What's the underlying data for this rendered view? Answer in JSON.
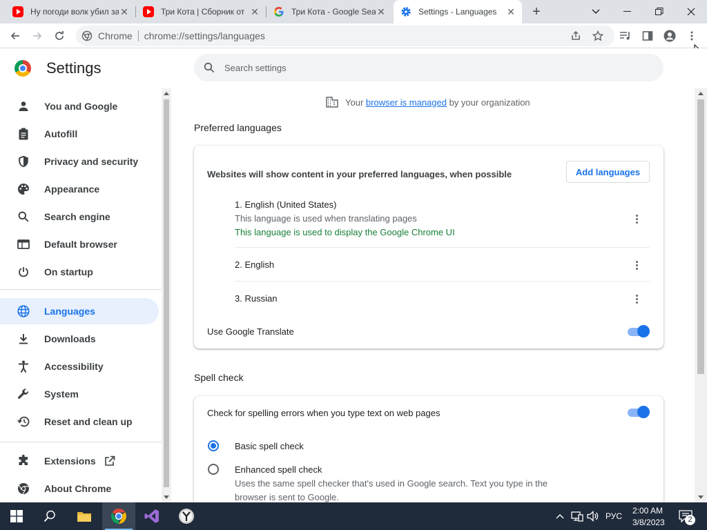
{
  "tabs": [
    {
      "title": "Ну погоди волк убил зайца",
      "icon": "youtube-icon"
    },
    {
      "title": "Три Кота | Сборник от",
      "icon": "youtube-icon"
    },
    {
      "title": "Три Кота - Google Search",
      "icon": "google-icon"
    },
    {
      "title": "Settings - Languages",
      "icon": "settings-gear-icon",
      "active": true
    }
  ],
  "toolbar": {
    "site_label": "Chrome",
    "url": "chrome://settings/languages"
  },
  "settings": {
    "title": "Settings",
    "search_placeholder": "Search settings"
  },
  "sidebar": {
    "items": [
      {
        "label": "You and Google",
        "icon": "person-icon"
      },
      {
        "label": "Autofill",
        "icon": "clipboard-icon"
      },
      {
        "label": "Privacy and security",
        "icon": "shield-icon"
      },
      {
        "label": "Appearance",
        "icon": "palette-icon"
      },
      {
        "label": "Search engine",
        "icon": "search-icon"
      },
      {
        "label": "Default browser",
        "icon": "browser-window-icon"
      },
      {
        "label": "On startup",
        "icon": "power-icon"
      },
      {
        "label": "Languages",
        "icon": "globe-icon",
        "active": true
      },
      {
        "label": "Downloads",
        "icon": "download-icon"
      },
      {
        "label": "Accessibility",
        "icon": "accessibility-icon"
      },
      {
        "label": "System",
        "icon": "wrench-icon"
      },
      {
        "label": "Reset and clean up",
        "icon": "restore-icon"
      },
      {
        "label": "Extensions",
        "icon": "puzzle-icon"
      },
      {
        "label": "About Chrome",
        "icon": "chrome-icon"
      }
    ]
  },
  "managed": {
    "prefix": "Your",
    "link": "browser is managed",
    "suffix": "by your organization"
  },
  "preferred": {
    "section_title": "Preferred languages",
    "description": "Websites will show content in your preferred languages, when possible",
    "add_button": "Add languages",
    "languages": [
      {
        "name": "1. English (United States)",
        "note1": "This language is used when translating pages",
        "note2": "This language is used to display the Google Chrome UI"
      },
      {
        "name": "2. English"
      },
      {
        "name": "3. Russian"
      }
    ],
    "translate_label": "Use Google Translate",
    "translate_on": true
  },
  "spell": {
    "section_title": "Spell check",
    "check_label": "Check for spelling errors when you type text on web pages",
    "check_on": true,
    "basic_label": "Basic spell check",
    "enhanced_label": "Enhanced spell check",
    "enhanced_desc_1": "Uses the same spell checker that's used in Google search. Text you type in the",
    "enhanced_desc_2": "browser is sent to Google."
  },
  "taskbar": {
    "lang": "РУС",
    "time": "2:00 AM",
    "date": "3/8/2023",
    "notifications": "2"
  },
  "colors": {
    "accent": "#1a73e8",
    "active_bg": "#e8f0fe",
    "green": "#188038",
    "taskbar": "#1f2a3a"
  }
}
